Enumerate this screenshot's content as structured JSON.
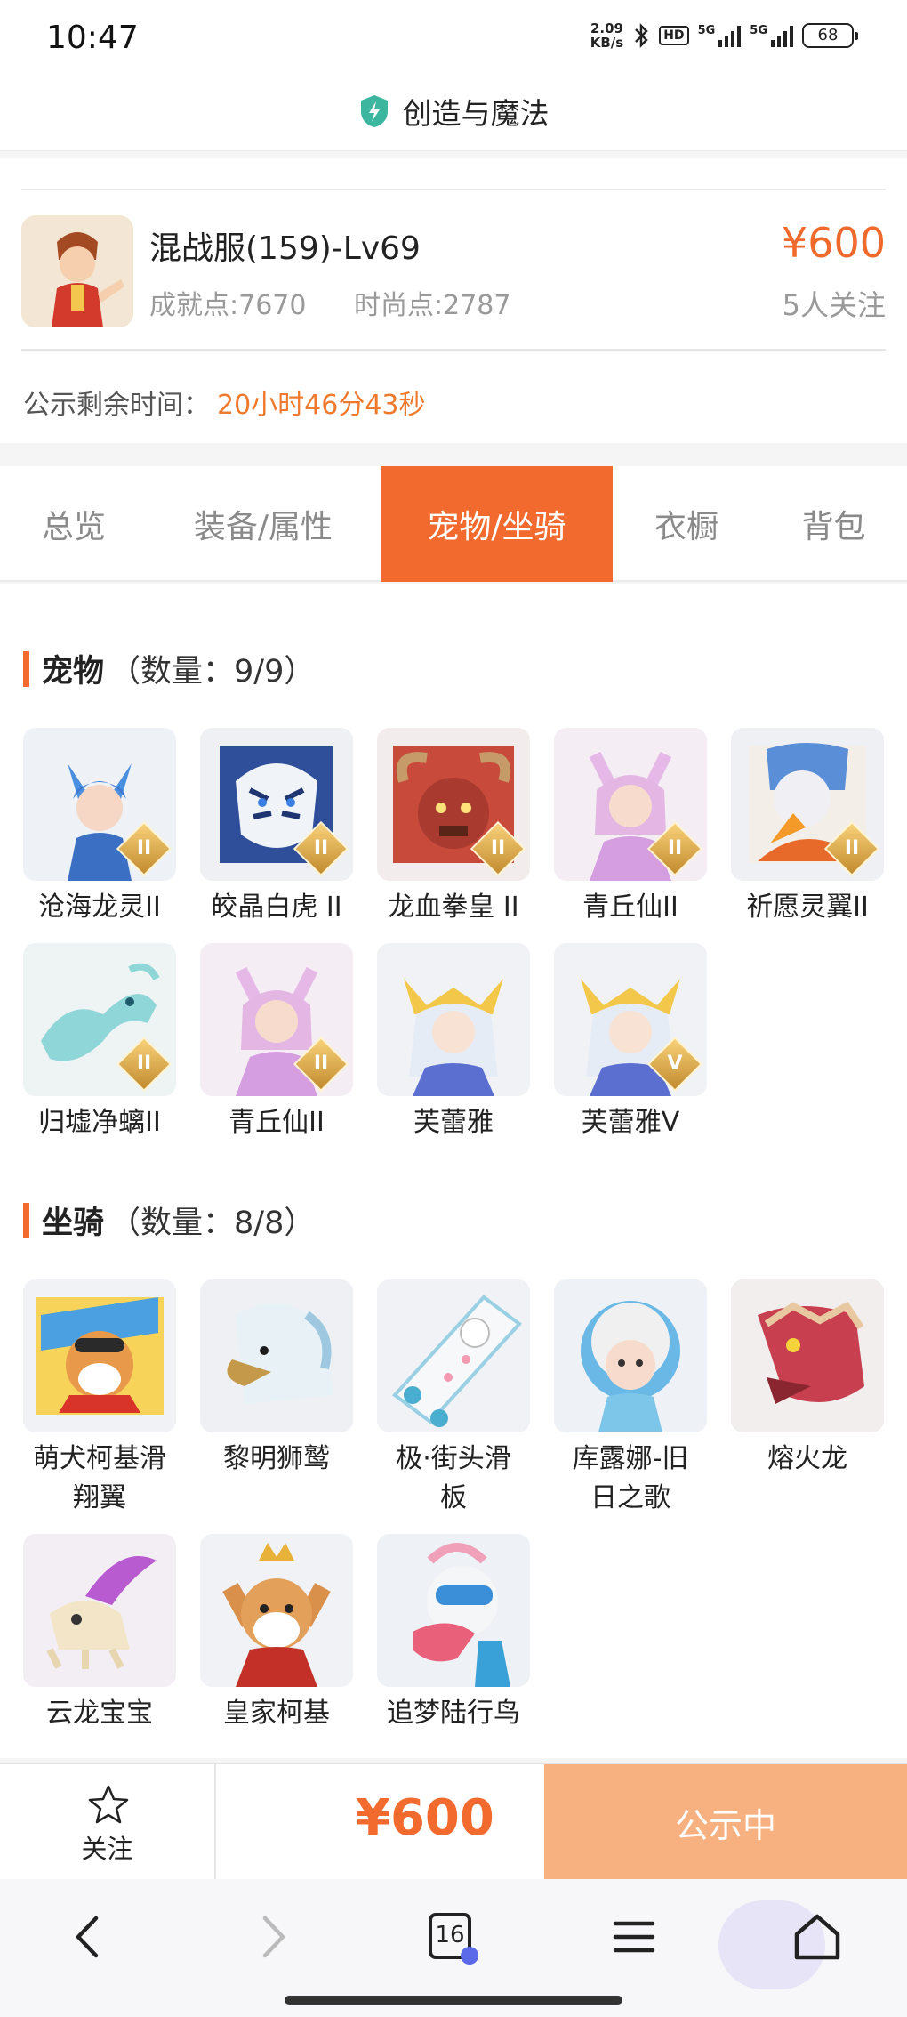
{
  "status_bar": {
    "time": "10:47",
    "net_speed_value": "2.09",
    "net_speed_unit": "KB/s",
    "hd_label": "HD",
    "signal_1": "5G",
    "signal_2": "5G",
    "battery": "68"
  },
  "header": {
    "title": "创造与魔法",
    "shield_icon": "shield-bolt-icon",
    "accent_color": "#3db6a0"
  },
  "summary": {
    "role_name": "混战服(159)-Lv69",
    "achievement": "成就点:7670",
    "fashion": "时尚点:2787",
    "price": "¥600",
    "followers": "5人关注",
    "countdown_label": "公示剩余时间：",
    "countdown_value": "20小时46分43秒"
  },
  "tabs": [
    {
      "label": "总览",
      "active": false
    },
    {
      "label": "装备/属性",
      "active": false
    },
    {
      "label": "宠物/坐骑",
      "active": true
    },
    {
      "label": "衣橱",
      "active": false
    },
    {
      "label": "背包",
      "active": false
    }
  ],
  "pets": {
    "title": "宠物",
    "count": "（数量：9/9）",
    "items": [
      {
        "name": "沧海龙灵II",
        "badge": "II"
      },
      {
        "name": "皎晶白虎 II",
        "badge": "II"
      },
      {
        "name": "龙血拳皇 II",
        "badge": "II"
      },
      {
        "name": "青丘仙II",
        "badge": "II"
      },
      {
        "name": "祈愿灵翼II",
        "badge": "II"
      },
      {
        "name": "归墟净螭II",
        "badge": "II"
      },
      {
        "name": "青丘仙II",
        "badge": "II"
      },
      {
        "name": "芙蕾雅",
        "badge": ""
      },
      {
        "name": "芙蕾雅V",
        "badge": "V"
      }
    ]
  },
  "mounts": {
    "title": "坐骑",
    "count": "（数量：8/8）",
    "items": [
      {
        "name_line1": "萌犬柯基滑",
        "name_line2": "翔翼"
      },
      {
        "name_line1": "黎明狮鹫",
        "name_line2": ""
      },
      {
        "name_line1": "极·街头滑",
        "name_line2": "板"
      },
      {
        "name_line1": "库露娜-旧",
        "name_line2": "日之歌"
      },
      {
        "name_line1": "熔火龙",
        "name_line2": ""
      },
      {
        "name_line1": "云龙宝宝",
        "name_line2": ""
      },
      {
        "name_line1": "皇家柯基",
        "name_line2": ""
      },
      {
        "name_line1": "追梦陆行鸟",
        "name_line2": ""
      }
    ]
  },
  "bottom_bar": {
    "follow_label": "关注",
    "price": "¥600",
    "status_label": "公示中"
  },
  "nav": {
    "back_icon": "back-arrow-icon",
    "forward_icon": "forward-arrow-icon",
    "tabs_count": "16",
    "menu_icon": "menu-icon",
    "home_icon": "home-icon"
  },
  "colors": {
    "accent": "#f26a2e",
    "price": "#f16a2b",
    "button_disabled": "#f7b07f"
  }
}
